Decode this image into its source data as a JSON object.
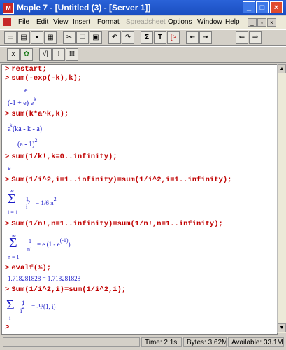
{
  "window": {
    "title": "Maple 7 - [Untitled (3) - [Server 1]]",
    "app_icon_glyph": "M",
    "min_glyph": "_",
    "max_glyph": "□",
    "close_glyph": "×"
  },
  "menus": [
    "File",
    "Edit",
    "View",
    "Insert",
    "Format",
    "Spreadsheet",
    "Options",
    "Window",
    "Help"
  ],
  "toolbar1_icons": [
    "new-file-icon",
    "open-icon",
    "save-icon",
    "print-icon",
    "cut-icon",
    "copy-icon",
    "paste-icon",
    "undo-icon",
    "redo-icon",
    "sigma-icon",
    "text-icon",
    "input-icon",
    "indent-left-icon",
    "outdent-icon",
    "back-icon",
    "forward-icon"
  ],
  "toolbar1_glyphs": {
    "sigma": "Σ",
    "text": "T",
    "input": "[>"
  },
  "toolbar2": {
    "x_glyph": "x",
    "leaf_glyph": "✿",
    "sqrt_glyph": "√|",
    "bang_glyph": "!",
    "bangs_glyph": "!!!"
  },
  "worksheet": {
    "prompt": ">",
    "l1_in": "restart;",
    "l2_in": "sum(-exp(-k),k);",
    "l2_out_num": "e",
    "l2_out_den": "(-1 + e) e",
    "l2_out_sup": "k",
    "l3_in": "sum(k*a^k,k);",
    "l3_out_num": "a (ka - k - a)",
    "l3_out_num_sup": "k",
    "l3_out_den": "(a - 1)",
    "l3_out_den_sup": "2",
    "l4_in": "sum(1/k!,k=0..infinity);",
    "l4_out": "e",
    "l5_in": "Sum(1/i^2,i=1..infinity)=sum(1/i^2,i=1..infinity);",
    "l5_sigma": "Σ",
    "l5_top": "∞",
    "l5_bottom": "i = 1",
    "l5_frac_num": "1",
    "l5_frac_den": "i",
    "l5_frac_den_sup": "2",
    "l5_rhs": "= 1/6 π",
    "l5_rhs_sup": "2",
    "l6_in": "Sum(1/n!,n=1..infinity)=sum(1/n!,n=1..infinity);",
    "l6_sigma": "Σ",
    "l6_top": "∞",
    "l6_bottom": "n = 1",
    "l6_frac_num": "1",
    "l6_frac_den": "n!",
    "l6_rhs": "= e (1 - e",
    "l6_rhs_sup": "(-1)",
    "l6_rhs_end": ")",
    "l7_in": "evalf(%);",
    "l7_out": "1.718281828 = 1.718281828",
    "l8_in": "Sum(1/i^2,i)=sum(1/i^2,i);",
    "l8_sigma": "Σ",
    "l8_bottom": "i",
    "l8_frac_num": "1",
    "l8_frac_den": "i",
    "l8_frac_den_sup": "2",
    "l8_rhs": "= -Ψ(1, i)"
  },
  "status": {
    "time_label": "Time: 2.1s",
    "bytes_label": "Bytes: 3.62M",
    "available_label": "Available: 33.1M"
  },
  "colors": {
    "input": "#c00000",
    "output": "#1c1cc8",
    "titlebar": "#2a62d8"
  }
}
